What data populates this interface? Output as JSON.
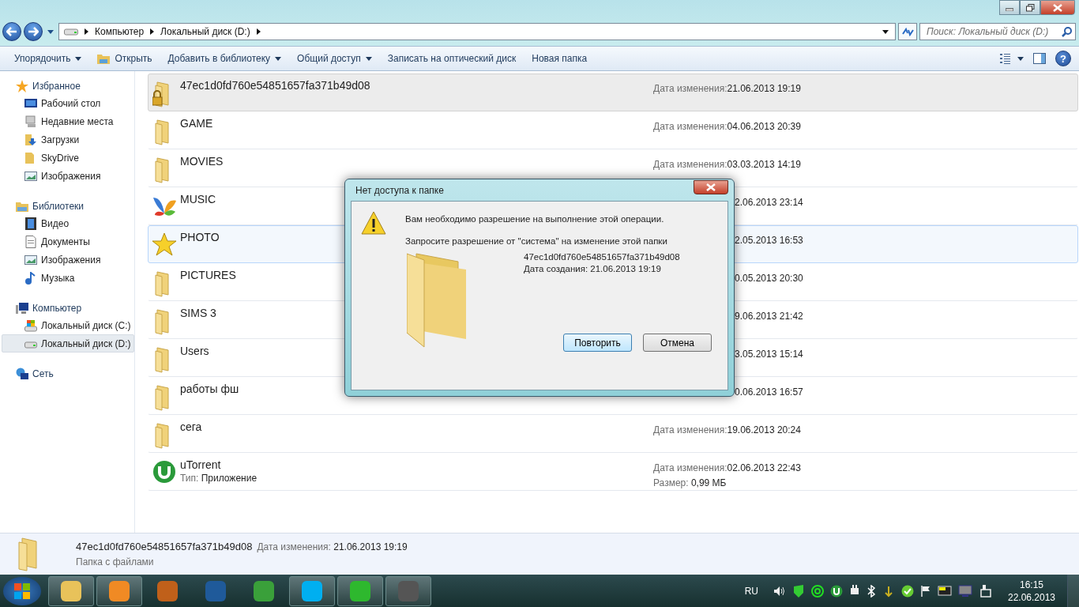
{
  "address": {
    "crumbs": [
      "Компьютер",
      "Локальный диск (D:)"
    ],
    "search_placeholder": "Поиск: Локальный диск (D:)"
  },
  "toolbar": {
    "items": [
      {
        "label": "Упорядочить",
        "dropdown": true
      },
      {
        "label": "Открыть",
        "dropdown": false
      },
      {
        "label": "Добавить в библиотеку",
        "dropdown": true
      },
      {
        "label": "Общий доступ",
        "dropdown": true
      },
      {
        "label": "Записать на оптический диск",
        "dropdown": false
      },
      {
        "label": "Новая папка",
        "dropdown": false
      }
    ],
    "help": "?"
  },
  "sidebar": {
    "sections": [
      {
        "label": "Избранное",
        "children": [
          {
            "label": "Рабочий стол",
            "selected": false
          },
          {
            "label": "Недавние места",
            "selected": false
          },
          {
            "label": "Загрузки",
            "selected": false
          },
          {
            "label": "SkyDrive",
            "selected": false
          },
          {
            "label": "Изображения",
            "selected": false
          }
        ]
      },
      {
        "label": "Библиотеки",
        "children": [
          {
            "label": "Видео",
            "selected": false
          },
          {
            "label": "Документы",
            "selected": false
          },
          {
            "label": "Изображения",
            "selected": false
          },
          {
            "label": "Музыка",
            "selected": false
          }
        ]
      },
      {
        "label": "Компьютер",
        "children": [
          {
            "label": "Локальный диск (C:)",
            "selected": false
          },
          {
            "label": "Локальный диск (D:)",
            "selected": true
          }
        ]
      },
      {
        "label": "Сеть"
      }
    ]
  },
  "files": [
    {
      "kind": "locked-folder",
      "name": "47ec1d0fd760e54851657fa371b49d08",
      "modified_label": "Дата изменения:",
      "modified": "21.06.2013 19:19",
      "selected": true,
      "hovered": false
    },
    {
      "kind": "folder",
      "name": "GAME",
      "modified_label": "Дата изменения:",
      "modified": "04.06.2013 20:39",
      "selected": false,
      "hovered": false
    },
    {
      "kind": "folder",
      "name": "MOVIES",
      "modified_label": "Дата изменения:",
      "modified": "03.03.2013 14:19",
      "selected": false,
      "hovered": false
    },
    {
      "kind": "music-folder",
      "name": "MUSIC",
      "modified": "2.06.2013 23:14",
      "selected": false,
      "hovered": false
    },
    {
      "kind": "star-folder",
      "name": "PHOTO",
      "modified": "2.05.2013 16:53",
      "selected": false,
      "hovered": true
    },
    {
      "kind": "folder",
      "name": "PICTURES",
      "modified": "0.05.2013 20:30",
      "selected": false,
      "hovered": false
    },
    {
      "kind": "folder",
      "name": "SIMS 3",
      "modified": "9.06.2013 21:42",
      "selected": false,
      "hovered": false
    },
    {
      "kind": "folder",
      "name": "Users",
      "modified": "3.05.2013 15:14",
      "selected": false,
      "hovered": false
    },
    {
      "kind": "folder",
      "name": "работы фш",
      "modified": "0.06.2013 16:57",
      "selected": false,
      "hovered": false
    },
    {
      "kind": "folder",
      "name": "сега",
      "modified_label": "Дата изменения:",
      "modified": "19.06.2013 20:24",
      "selected": false,
      "hovered": false
    },
    {
      "kind": "app",
      "name": "uTorrent",
      "type_label": "Тип:",
      "type": "Приложение",
      "modified_label": "Дата изменения:",
      "modified": "02.06.2013 22:43",
      "size_label": "Размер:",
      "size": "0,99 МБ",
      "selected": false,
      "hovered": false
    }
  ],
  "details": {
    "name": "47ec1d0fd760e54851657fa371b49d08",
    "modified_label": "Дата изменения:",
    "modified": "21.06.2013 19:19",
    "type": "Папка с файлами"
  },
  "dialog": {
    "title": "Нет доступа к папке",
    "message": "Вам необходимо разрешение на выполнение этой операции.",
    "hint": "Запросите разрешение от \"система\" на изменение этой папки",
    "item_name": "47ec1d0fd760e54851657fa371b49d08",
    "item_created": "Дата создания: 21.06.2013 19:19",
    "buttons": [
      {
        "label": "Повторить",
        "default": true
      },
      {
        "label": "Отмена",
        "default": false
      }
    ]
  },
  "taskbar": {
    "buttons": [
      {
        "running": true
      },
      {
        "running": true
      },
      {
        "running": false
      },
      {
        "running": false
      },
      {
        "running": false
      },
      {
        "running": true
      },
      {
        "running": true
      },
      {
        "running": true
      }
    ],
    "language": "RU",
    "time": "16:15",
    "date": "22.06.2013"
  }
}
